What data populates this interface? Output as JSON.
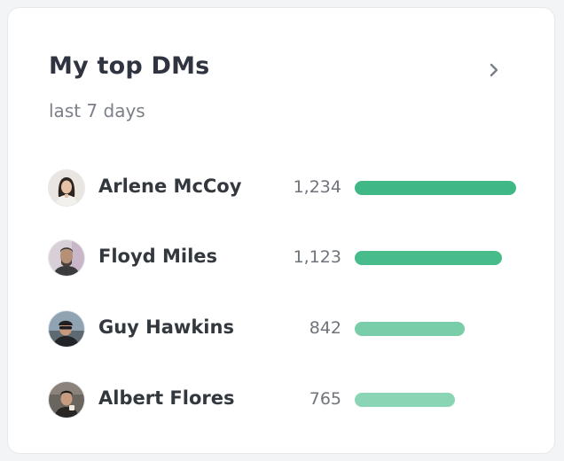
{
  "widget": {
    "title": "My top DMs",
    "subtitle": "last 7 days",
    "open_icon": "chevron-right-icon"
  },
  "dms": [
    {
      "name": "Arlene McCoy",
      "count_label": "1,234",
      "value": 1234,
      "bar_color": "#3fb885",
      "avatar_icon": "avatar-photo"
    },
    {
      "name": "Floyd Miles",
      "count_label": "1,123",
      "value": 1123,
      "bar_color": "#47bb89",
      "avatar_icon": "avatar-photo"
    },
    {
      "name": "Guy Hawkins",
      "count_label": "842",
      "value": 842,
      "bar_color": "#79cda8",
      "avatar_icon": "avatar-photo"
    },
    {
      "name": "Albert Flores",
      "count_label": "765",
      "value": 765,
      "bar_color": "#8ad5b4",
      "avatar_icon": "avatar-photo"
    }
  ],
  "colors": {
    "title": "#2f3440",
    "muted": "#7b7f88",
    "card_border": "#e6e8eb"
  }
}
